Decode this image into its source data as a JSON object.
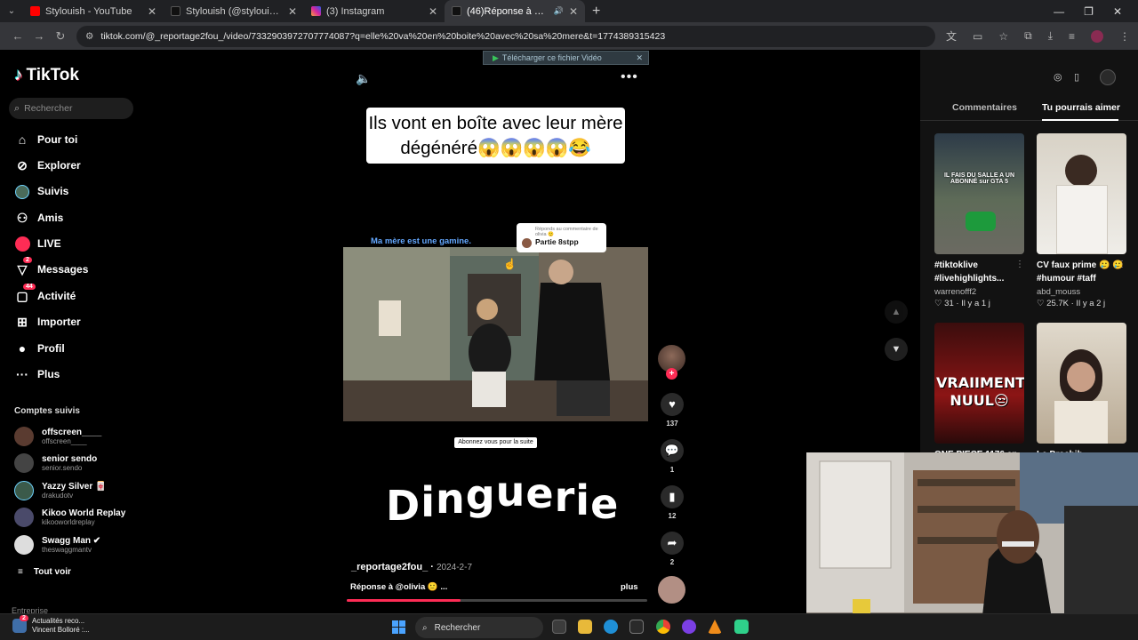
{
  "browser": {
    "tabs": [
      {
        "title": "Stylouish - YouTube",
        "favicon": "youtube-icon",
        "color": "#ff0000"
      },
      {
        "title": "Stylouish (@stylouish) | TikTok",
        "favicon": "tiktok-icon",
        "color": "#111111"
      },
      {
        "title": "(3) Instagram",
        "favicon": "instagram-icon",
        "color": "#d6249f"
      },
      {
        "title": "(46)Réponse à @olivia",
        "favicon": "tiktok-icon",
        "color": "#111111"
      }
    ],
    "new_tab": "+",
    "url": "tiktok.com/@_reportage2fou_/video/7332903972707774087?q=elle%20va%20en%20boite%20avec%20sa%20mere&t=1774389315423"
  },
  "tiktok": {
    "logo": "TikTok",
    "search_placeholder": "Rechercher",
    "menu": [
      {
        "label": "Pour toi",
        "icon": "home-icon"
      },
      {
        "label": "Explorer",
        "icon": "compass-icon"
      },
      {
        "label": "Suivis",
        "icon": "following-icon"
      },
      {
        "label": "Amis",
        "icon": "friends-icon"
      },
      {
        "label": "LIVE",
        "icon": "live-icon"
      },
      {
        "label": "Messages",
        "icon": "messages-icon",
        "badge": "2"
      },
      {
        "label": "Activité",
        "icon": "activity-icon",
        "badge": "44"
      },
      {
        "label": "Importer",
        "icon": "upload-icon"
      },
      {
        "label": "Profil",
        "icon": "profile-icon"
      },
      {
        "label": "Plus",
        "icon": "more-icon"
      }
    ],
    "followed_title": "Comptes suivis",
    "followed": [
      {
        "name": "offscreen____",
        "handle": "offscreen____"
      },
      {
        "name": "senior sendo",
        "handle": "senior.sendo"
      },
      {
        "name": "Yazzy Silver 🀄",
        "handle": "drakudotv"
      },
      {
        "name": "Kikoo World Replay",
        "handle": "kikooworldreplay"
      },
      {
        "name": "Swagg Man ✔",
        "handle": "theswaggmantv"
      }
    ],
    "see_all": "Tout voir",
    "corporate": "Entreprise"
  },
  "video": {
    "download_banner": "Télécharger ce fichier Vidéo",
    "title_card": "Ils vont en boîte avec leur mère dégénéré😱😱😱😱😂",
    "caption_top": "Ma mère est une gamine.",
    "reply_small": "Réponds au commentaire de olivia 🙂",
    "reply_main": "Partie 8stpp",
    "subscribe_chip": "Abonnez vous pour la suite",
    "big_text": [
      "D",
      "i",
      "n",
      "g",
      "u",
      "e",
      "r",
      "i",
      "e"
    ],
    "author": "_reportage2fou_",
    "date": "2024-2-7",
    "description": "Réponse à @olivia 🙂 ...",
    "more": "plus",
    "progress": 0.38,
    "likes": "137",
    "comments": "1",
    "saves": "12",
    "shares": "2"
  },
  "right_panel": {
    "tabs": [
      "Commentaires",
      "Tu pourrais aimer"
    ],
    "cards": [
      {
        "caption": "#tiktoklive #livehighlights...",
        "author": "warrenofff2",
        "stats": "♡ 31 · Il y a 1 j",
        "overlay": "IL FAIS DU SALLE A UN ABONNÉ sur GTA 5"
      },
      {
        "caption": "CV faux prime 🥲 🥲 #humour #taff",
        "author": "abd_mouss",
        "stats": "♡ 25.7K · Il y a 2 j",
        "overlay": ""
      },
      {
        "caption": "ONE PIECE 1176 en i...",
        "author": "",
        "stats": "",
        "overlay": "VRAIIMENT NUUL😒"
      },
      {
        "caption": "Le Dracbib...",
        "author": "",
        "stats": "",
        "overlay": ""
      }
    ]
  },
  "taskbar": {
    "news_title": "Actualités reco...",
    "news_sub": "Vincent Bolloré :...",
    "news_badge": "2",
    "search": "Rechercher"
  }
}
